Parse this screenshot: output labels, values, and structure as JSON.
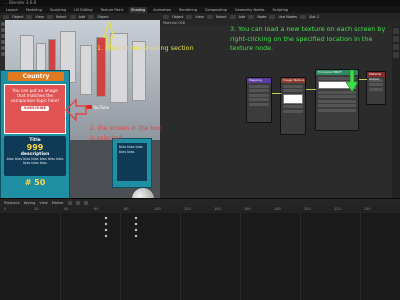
{
  "titlebar": {
    "title": "... Blender 3.6.8"
  },
  "workspace_tabs": [
    "Layout",
    "Modeling",
    "Sculpting",
    "UV Editing",
    "Texture Paint",
    "Shading",
    "Animation",
    "Rendering",
    "Compositing",
    "Geometry Nodes",
    "Scripting"
  ],
  "active_tab_index": 5,
  "viewport": {
    "header_items": [
      "Object",
      "View",
      "Select",
      "Add",
      "Object"
    ],
    "card": {
      "title": "Country",
      "image_text": "You can put an image that matches the comparison topic here!",
      "subscribe_label": "SUBSCRIBE",
      "info_title": "Title",
      "info_number": "999",
      "info_desc_title": "description",
      "info_desc_body": "blas blas blas blas blas blas blas blas blas blas",
      "price": "# 50"
    },
    "card2_text": "blas blas blas blas blas",
    "youtube_label": "YouTube"
  },
  "annotations": {
    "yellow": "1. goes to the shading section",
    "red_line1": "2. the screen in the box",
    "red_line2": "is selected",
    "green": "3. You can load a new texture on each screen by right-clicking on the specified location in the texture node."
  },
  "node_editor": {
    "header_items": [
      "Object",
      "View",
      "Select",
      "Add",
      "Node",
      "Use Nodes",
      "Slot 2"
    ],
    "subheader": "Material.008",
    "nodes": {
      "texture_title": "Image Texture",
      "mapping_title": "Mapping",
      "bsdf_title": "Principled BSDF",
      "output_title": "Material Output"
    }
  },
  "timeline": {
    "header_items": [
      "Playback",
      "Keying",
      "View",
      "Marker"
    ],
    "ruler_labels": [
      "0",
      "20",
      "40",
      "60",
      "80",
      "100",
      "120",
      "140",
      "160",
      "180",
      "200",
      "220",
      "240"
    ]
  },
  "colors": {
    "annotation_yellow": "#e6e040",
    "annotation_red": "#e04545",
    "annotation_green": "#3ee04a",
    "card_teal": "#1f8fa3",
    "card_orange": "#e07a1f"
  }
}
